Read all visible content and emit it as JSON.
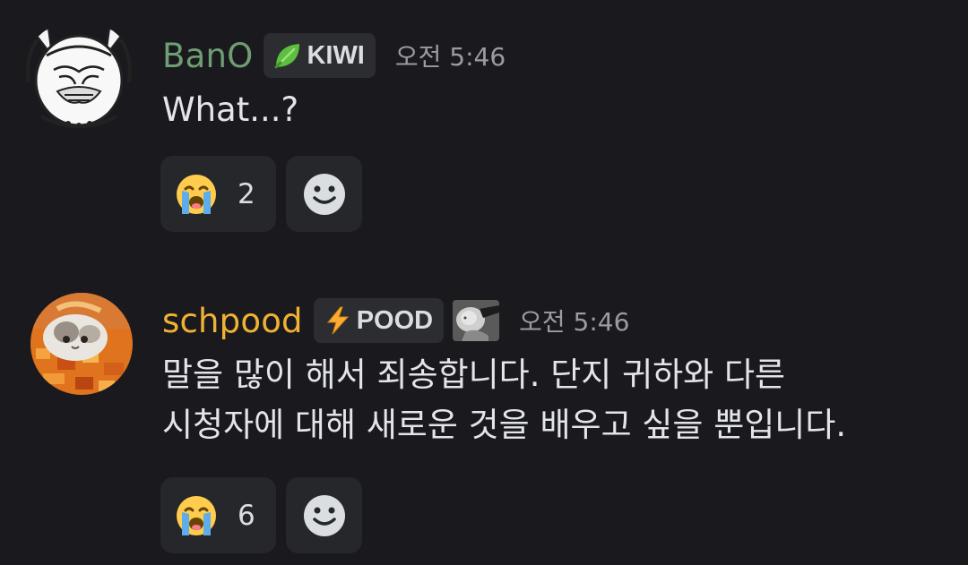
{
  "messages": [
    {
      "username": "BanO",
      "username_color": "#6e9e72",
      "tag": {
        "icon": "leaf-icon",
        "label": "KIWI"
      },
      "timestamp": "오전 5:46",
      "content": "What...?",
      "reactions": [
        {
          "emoji": "loudly-crying-face-icon",
          "count": "2"
        }
      ],
      "add_reaction_icon": "smiley-add-reaction-icon"
    },
    {
      "username": "schpood",
      "username_color": "#f0b232",
      "tag": {
        "icon": "lightning-bolt-icon",
        "label": "POOD"
      },
      "role_icon": "baby-photo-role-icon",
      "timestamp": "오전 5:46",
      "content_lines": [
        "말을 많이 해서 죄송합니다. 단지 귀하와 다른",
        "시청자에 대해 새로운 것을 배우고 싶을 뿐입니다."
      ],
      "reactions": [
        {
          "emoji": "loudly-crying-face-icon",
          "count": "6"
        }
      ],
      "add_reaction_icon": "smiley-add-reaction-icon"
    }
  ],
  "colors": {
    "background": "#1a1a1e",
    "tag_background": "#2b2d31",
    "reaction_background": "#26272b",
    "timestamp": "#9b9ba3"
  }
}
